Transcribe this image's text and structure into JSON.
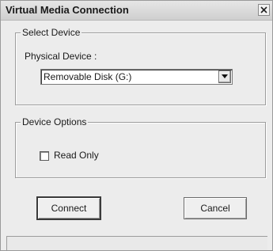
{
  "window": {
    "title": "Virtual Media Connection",
    "close_icon": "close-icon"
  },
  "select_device": {
    "group_title": "Select Device",
    "physical_device_label": "Physical Device :",
    "selected_device": "Removable Disk (G:)",
    "dropdown_icon": "chevron-down-icon"
  },
  "device_options": {
    "group_title": "Device Options",
    "read_only_label": "Read Only",
    "read_only_checked": false
  },
  "buttons": {
    "connect_label": "Connect",
    "cancel_label": "Cancel"
  }
}
